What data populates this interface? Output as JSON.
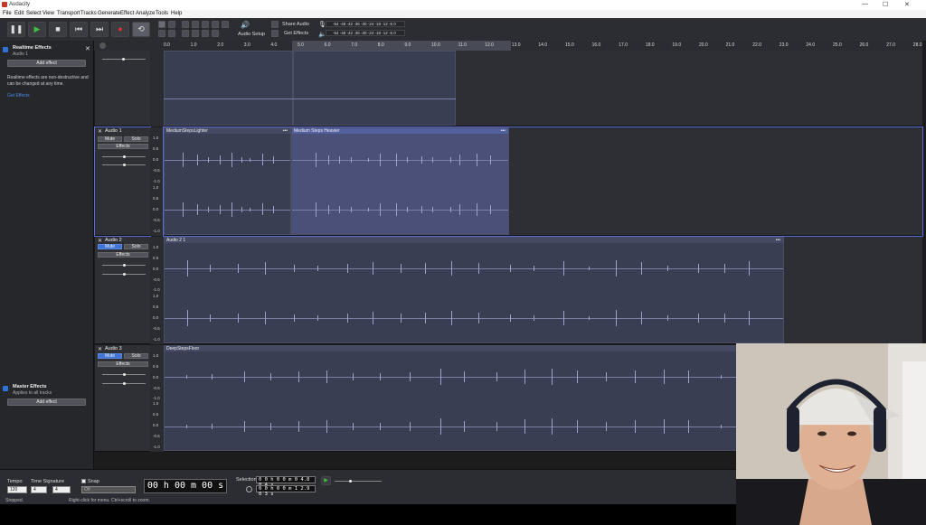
{
  "window": {
    "title": "Audacity",
    "min": "—",
    "max": "☐",
    "close": "✕"
  },
  "menu": [
    "File",
    "Edit",
    "Select",
    "View",
    "Transport",
    "Tracks",
    "Generate",
    "Effect",
    "Analyze",
    "Tools",
    "Help"
  ],
  "toolbar": {
    "audio_setup": "Audio Setup",
    "share_audio": "Share Audio",
    "get_effects": "Get Effects",
    "meter_ticks_top": [
      "-54",
      "-48",
      "-42",
      "-36",
      "-30",
      "-24",
      "-18",
      "-12",
      "-6",
      "0"
    ],
    "meter_ticks_bottom": [
      "-54",
      "-48",
      "-42",
      "-36",
      "-30",
      "-24",
      "-18",
      "-12",
      "-6",
      "0"
    ]
  },
  "left_panel": {
    "realtime_title": "Realtime Effects",
    "realtime_track": "Audio 1",
    "add_effect": "Add effect",
    "info": "Realtime effects are non-destructive and can be changed at any time.",
    "link": "Get Effects",
    "master_title": "Master Effects",
    "master_sub": "Applies to all tracks",
    "master_add": "Add effect"
  },
  "ruler": [
    "0.0",
    "1.0",
    "2.0",
    "3.0",
    "4.0",
    "5.0",
    "6.0",
    "7.0",
    "8.0",
    "9.0",
    "10.0",
    "11.0",
    "12.0",
    "13.0",
    "14.0",
    "15.0",
    "16.0",
    "17.0",
    "18.0",
    "19.0",
    "20.0",
    "21.0",
    "22.0",
    "23.0",
    "24.0",
    "25.0",
    "26.0",
    "27.0",
    "28.0"
  ],
  "tracks": [
    {
      "name": "Audio 1",
      "mute": "Mute",
      "solo": "Solo",
      "effects": "Effects",
      "clips": [
        "MediumStepsLighter",
        "Medium Steps Heavier"
      ],
      "scale": [
        "1.0",
        "0.5",
        "0.0",
        "-0.5",
        "-1.0",
        "1.0",
        "0.5",
        "0.0",
        "-0.5",
        "-1.0"
      ]
    },
    {
      "name": "Audio 2",
      "mute": "Mute",
      "solo": "Solo",
      "effects": "Effects",
      "clips": [
        "Audio 2 1"
      ],
      "scale": [
        "1.0",
        "0.5",
        "0.0",
        "-0.5",
        "-1.0",
        "1.0",
        "0.5",
        "0.0",
        "-0.5",
        "-1.0"
      ]
    },
    {
      "name": "Audio 3",
      "mute": "Mute",
      "solo": "Solo",
      "effects": "Effects",
      "clips": [
        "DeepStepsFloor"
      ],
      "scale": [
        "1.0",
        "0.5",
        "0.0",
        "-0.5",
        "-1.0",
        "1.0",
        "0.5",
        "0.0",
        "-0.5",
        "-1.0"
      ]
    }
  ],
  "bottom": {
    "tempo_label": "Tempo",
    "tempo": "120",
    "sig_label": "Time Signature",
    "sig_num": "4",
    "sig_den": "4",
    "snap_label": "Snap",
    "snap_value": "Off",
    "time": "00 h 00 m 00 s",
    "selection_label": "Selection",
    "sel_start": "0 0 h 0 0 m 0 4.8 0 4 s",
    "sel_end": "0 0 h 0 0 m 1 2.9 0 3 s"
  },
  "status": {
    "left": "Stopped.",
    "center": "Right-click for menu. Ctrl+scroll to zoom."
  },
  "colors": {
    "accent": "#3f73d8",
    "clip": "#3a3e52",
    "clip_selected": "#4a5078",
    "waveform": "#9ca2c9"
  },
  "icons": [
    "pause-icon",
    "play-icon",
    "stop-icon",
    "skip-start-icon",
    "skip-end-icon",
    "record-icon",
    "loop-icon",
    "gear-icon",
    "speaker-icon",
    "mic-icon"
  ]
}
